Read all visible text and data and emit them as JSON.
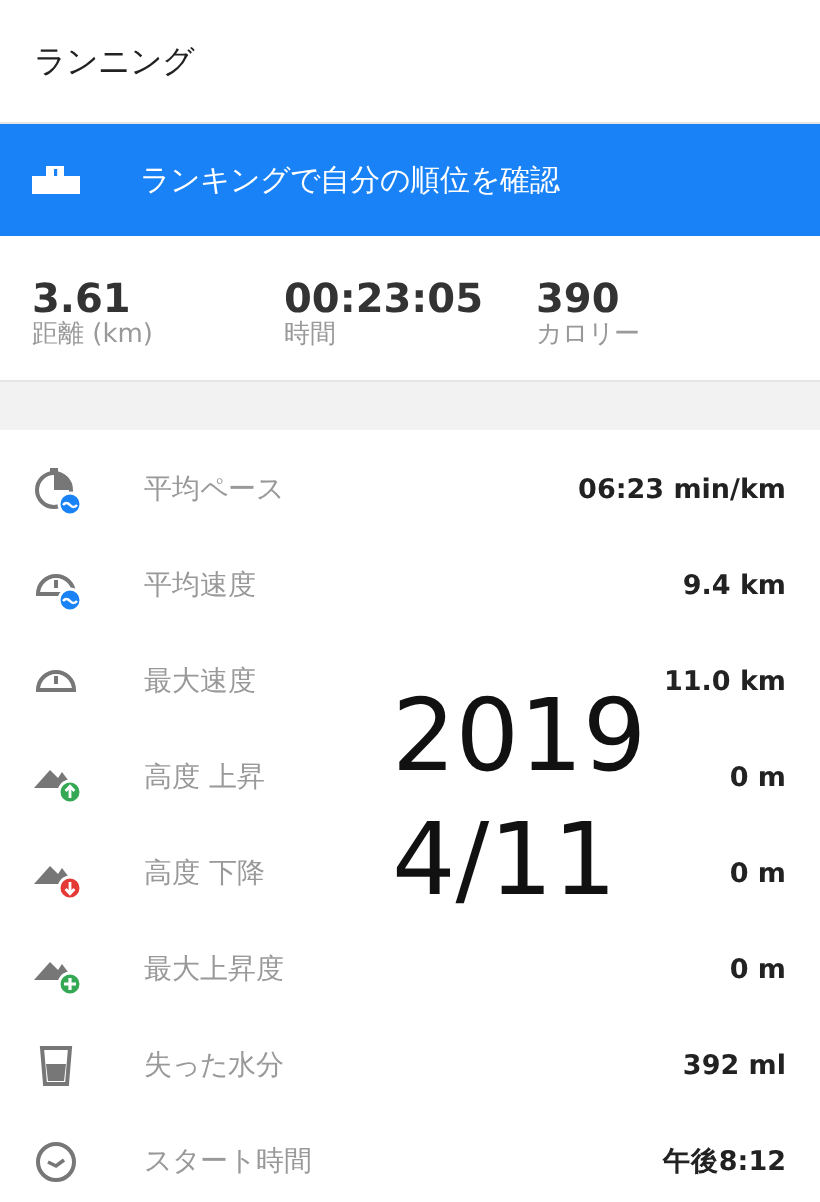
{
  "header": {
    "title": "ランニング"
  },
  "banner": {
    "text": "ランキングで自分の順位を確認"
  },
  "summary": [
    {
      "value": "3.61",
      "label": "距離 (km)"
    },
    {
      "value": "00:23:05",
      "label": "時間"
    },
    {
      "value": "390",
      "label": "カロリー"
    }
  ],
  "metrics": [
    {
      "kind": "pace",
      "label": "平均ペース",
      "value": "06:23 min/km"
    },
    {
      "kind": "avg-speed",
      "label": "平均速度",
      "value": "9.4 km"
    },
    {
      "kind": "max-speed",
      "label": "最大速度",
      "value": "11.0 km"
    },
    {
      "kind": "ascent",
      "label": "高度 上昇",
      "value": "0 m"
    },
    {
      "kind": "descent",
      "label": "高度 下降",
      "value": "0 m"
    },
    {
      "kind": "max-ascent",
      "label": "最大上昇度",
      "value": "0 m"
    },
    {
      "kind": "water",
      "label": "失った水分",
      "value": "392 ml"
    },
    {
      "kind": "clock",
      "label": "スタート時間",
      "value": "午後8:12"
    }
  ],
  "annotation": [
    "2019",
    "4/11"
  ]
}
